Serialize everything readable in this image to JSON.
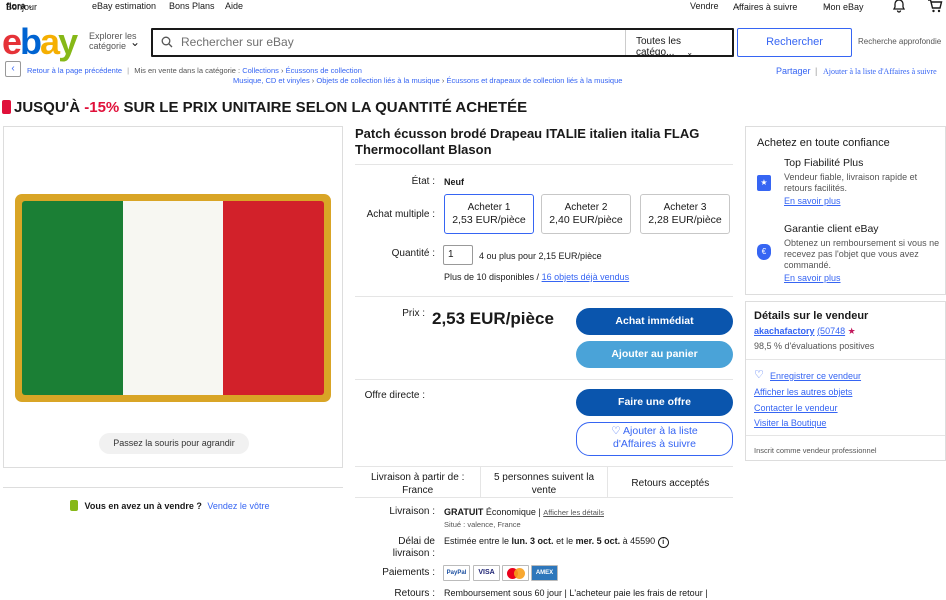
{
  "topnav": {
    "greeting": "Bonjour",
    "user": "flora",
    "estimation": "eBay estimation",
    "deals": "Bons Plans",
    "help": "Aide",
    "sell": "Vendre",
    "watchlist": "Affaires à suivre",
    "myebay": "Mon eBay"
  },
  "header": {
    "logo": {
      "e": "e",
      "b": "b",
      "a": "a",
      "y": "y"
    },
    "explore": "Explorer les catégorie",
    "search_placeholder": "Rechercher sur eBay",
    "search_category": "Toutes les catégo...",
    "search_button": "Rechercher",
    "advanced": "Recherche approfondie"
  },
  "breadcrumb": {
    "back": "Retour à la page précédente",
    "listed_in": "Mis en vente dans la catégorie :",
    "items": [
      "Collections",
      "Écussons de collection"
    ],
    "row2": [
      "Musique, CD et vinyles",
      "Objets de collection liés à la musique",
      "Écussons et drapeaux de collection liés à la musique"
    ],
    "share": "Partager",
    "add_watch": "Ajouter à la liste d'Affaires à suivre"
  },
  "promo": {
    "prefix": "JUSQU'À ",
    "percent": "-15%",
    "suffix": " SUR LE PRIX UNITAIRE SELON LA QUANTITÉ ACHETÉE"
  },
  "gallery": {
    "zoom_hint": "Passez la souris pour agrandir",
    "flag_colors": [
      "#1b7f35",
      "#f7f7f2",
      "#d2212a"
    ],
    "border_color": "#d9a526"
  },
  "sell_prompt": {
    "question": "Vous en avez un à vendre ?",
    "link": "Vendez le vôtre"
  },
  "item": {
    "title": "Patch écusson brodé Drapeau ITALIE italien italia FLAG Thermocollant Blason",
    "condition_label": "État :",
    "condition": "Neuf",
    "multi_label": "Achat multiple :",
    "options": [
      {
        "label": "Acheter 1",
        "price": "2,53 EUR/pièce"
      },
      {
        "label": "Acheter 2",
        "price": "2,40 EUR/pièce"
      },
      {
        "label": "Acheter 3",
        "price": "2,28 EUR/pièce"
      }
    ],
    "qty_label": "Quantité :",
    "qty_value": "1",
    "qty_bulk": "4 ou plus pour 2,15 EUR/pièce",
    "available": "Plus de 10 disponibles /",
    "sold": "16 objets déjà vendus",
    "price_label": "Prix :",
    "price": "2,53 EUR/pièce",
    "buy_now": "Achat immédiat",
    "add_cart": "Ajouter au panier",
    "offer_label": "Offre directe :",
    "make_offer": "Faire une offre",
    "watch_line1": "♡ Ajouter à la liste",
    "watch_line2": "d'Affaires à suivre"
  },
  "shipping_summary": {
    "cell1": "Livraison à partir de : France",
    "cell2": "5 personnes suivent la vente",
    "cell3": "Retours acceptés"
  },
  "details": {
    "shipping_label": "Livraison :",
    "shipping_free": "GRATUIT",
    "shipping_type": "Économique |",
    "shipping_link": "Afficher les détails",
    "location": "Situé : valence, France",
    "delay_label1": "Délai de",
    "delay_label2": "livraison :",
    "delay_prefix": "Estimée entre le",
    "delay_start": "lun. 3 oct.",
    "delay_mid": "et le",
    "delay_end": "mer. 5 oct.",
    "delay_to": "à 45590",
    "payments_label": "Paiements :",
    "payments": [
      "PayPal",
      "VISA",
      "MC",
      "AMEX"
    ],
    "returns_label": "Retours :",
    "returns": "Remboursement sous 60 jour | L'acheteur paie les frais de retour |"
  },
  "trust": {
    "title": "Achetez en toute confiance",
    "top_title": "Top Fiabilité Plus",
    "top_desc": "Vendeur fiable, livraison rapide et retours facilités.",
    "top_link": "En savoir plus",
    "guarantee_title": "Garantie client eBay",
    "guarantee_desc": "Obtenez un remboursement si vous ne recevez pas l'objet que vous avez commandé.",
    "guarantee_link": "En savoir plus"
  },
  "seller": {
    "title": "Détails sur le vendeur",
    "name": "akachafactory",
    "score": "(50748",
    "feedback": "98,5 % d'évaluations positives",
    "save": "Enregistrer ce vendeur",
    "other_items": "Afficher les autres objets",
    "contact": "Contacter le vendeur",
    "store": "Visiter la Boutique",
    "pro": "Inscrit comme vendeur professionnel"
  }
}
